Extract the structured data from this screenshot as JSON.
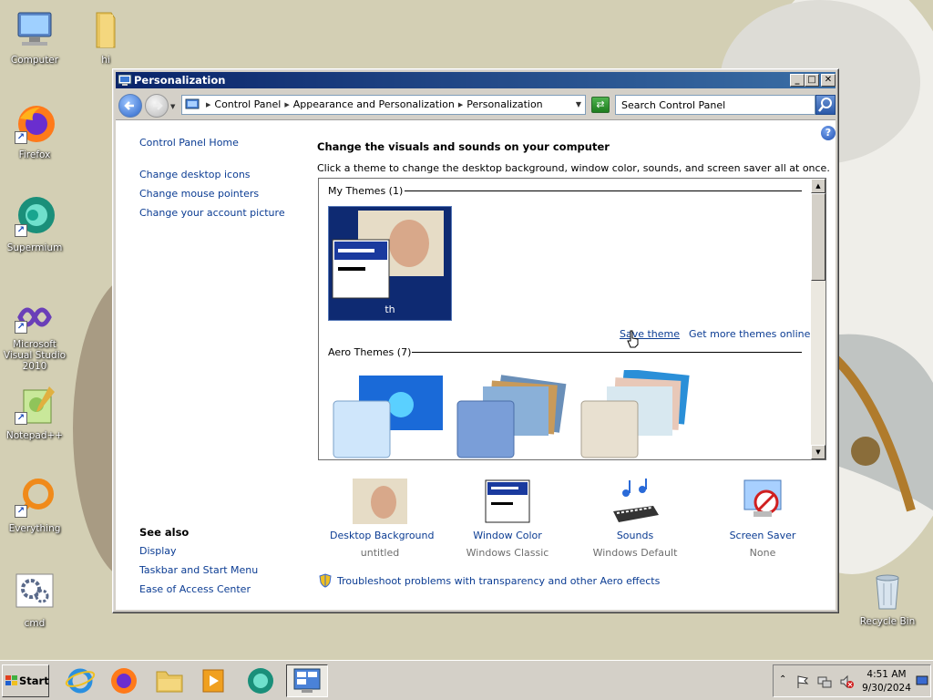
{
  "desktop": {
    "icons": [
      {
        "label": "Computer"
      },
      {
        "label": "hi"
      },
      {
        "label": "Firefox"
      },
      {
        "label": "Supermium"
      },
      {
        "label": "Microsoft Visual Studio 2010"
      },
      {
        "label": "Notepad++"
      },
      {
        "label": "Everything"
      },
      {
        "label": "cmd"
      },
      {
        "label": "Recycle Bin"
      }
    ]
  },
  "window": {
    "title": "Personalization",
    "controls": {
      "minimize": "_",
      "maximize": "□",
      "close": "✕"
    },
    "breadcrumb": [
      "Control Panel",
      "Appearance and Personalization",
      "Personalization"
    ],
    "search": {
      "placeholder": "Search Control Panel"
    },
    "sidebar": {
      "home": "Control Panel Home",
      "links": [
        "Change desktop icons",
        "Change mouse pointers",
        "Change your account picture"
      ],
      "see_also_heading": "See also",
      "see_also": [
        "Display",
        "Taskbar and Start Menu",
        "Ease of Access Center"
      ]
    },
    "main": {
      "heading": "Change the visuals and sounds on your computer",
      "subheading": "Click a theme to change the desktop background, window color, sounds, and screen saver all at once.",
      "my_themes_label": "My Themes (1)",
      "my_theme_name": "th",
      "save_theme": "Save theme",
      "get_more_themes": "Get more themes online",
      "aero_themes_label": "Aero Themes (7)"
    },
    "bottom_items": [
      {
        "label": "Desktop Background",
        "value": "untitled"
      },
      {
        "label": "Window Color",
        "value": "Windows Classic"
      },
      {
        "label": "Sounds",
        "value": "Windows Default"
      },
      {
        "label": "Screen Saver",
        "value": "None"
      }
    ],
    "troubleshoot": "Troubleshoot problems with transparency and other Aero effects"
  },
  "taskbar": {
    "start_label": "Start",
    "apps": [
      "internet-explorer",
      "firefox",
      "file-explorer",
      "media-player",
      "supermium",
      "control-panel"
    ],
    "clock": {
      "time": "4:51 AM",
      "date": "9/30/2024"
    }
  },
  "colors": {
    "titlebar_start": "#0a246a",
    "titlebar_end": "#3a6ea5",
    "link": "#0b3c93",
    "theme_thumb_bg": "#0e2a72",
    "face": "#d4d0c8"
  }
}
